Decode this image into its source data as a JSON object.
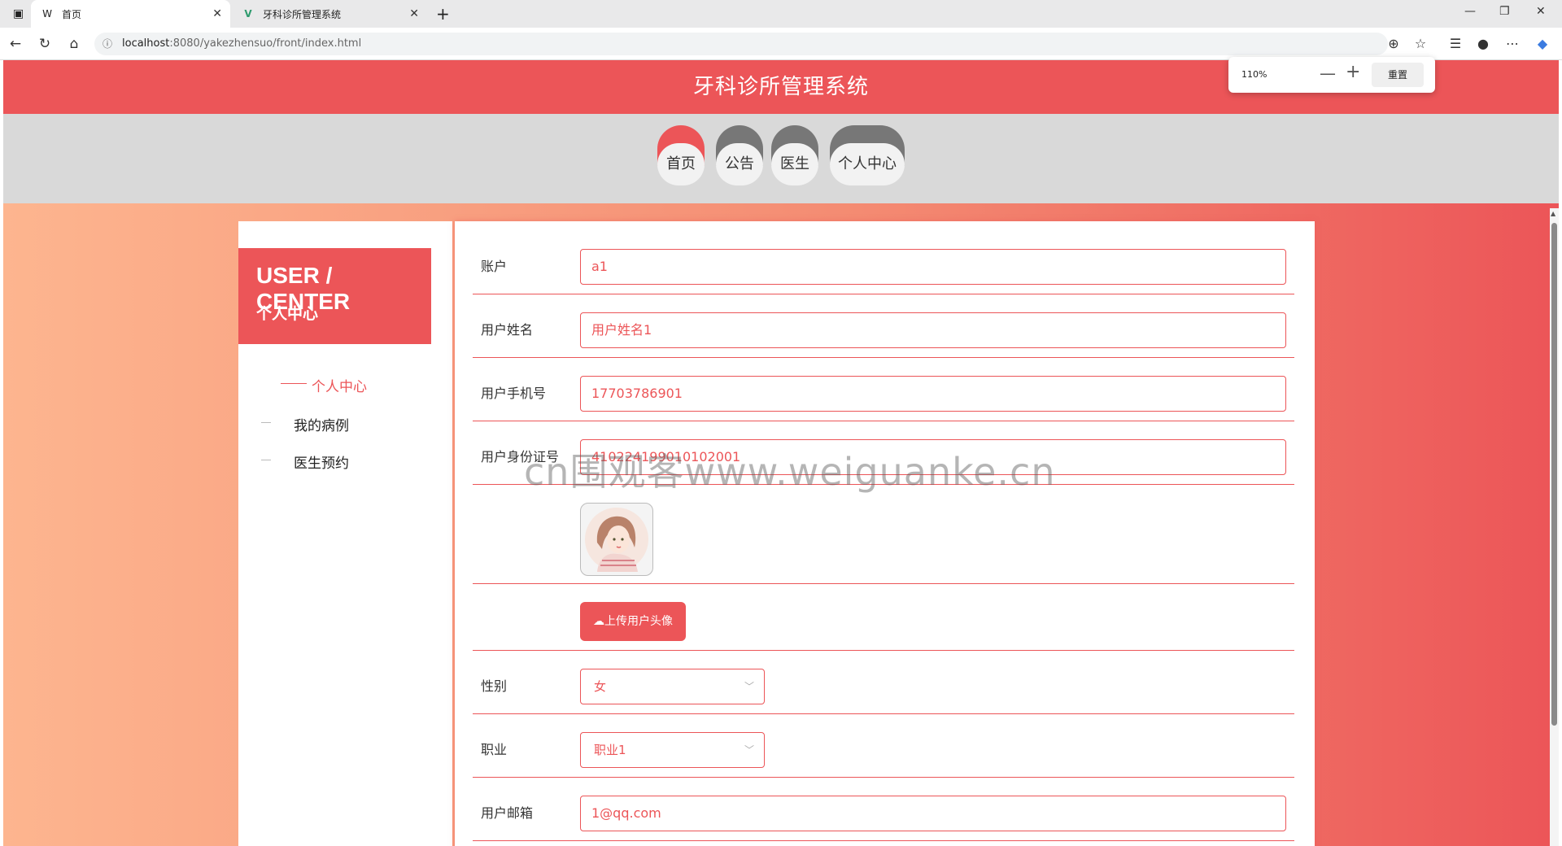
{
  "browser": {
    "tabs": [
      {
        "title": "首页",
        "favicon": "W"
      },
      {
        "title": "牙科诊所管理系统",
        "favicon": "V"
      }
    ],
    "url_host": "localhost",
    "url_rest": ":8080/yakezhensuo/front/index.html",
    "zoom": {
      "percent": "110%",
      "reset_label": "重置"
    }
  },
  "site": {
    "title": "牙科诊所管理系统",
    "nav": [
      {
        "label": "首页"
      },
      {
        "label": "公告"
      },
      {
        "label": "医生"
      },
      {
        "label": "个人中心"
      }
    ]
  },
  "sidebar": {
    "en_title": "USER / CENTER",
    "cn_title": "个人中心",
    "items": [
      {
        "label": "个人中心"
      },
      {
        "label": "我的病例"
      },
      {
        "label": "医生预约"
      }
    ]
  },
  "form": {
    "account": {
      "label": "账户",
      "value": "a1"
    },
    "name": {
      "label": "用户姓名",
      "value": "用户姓名1"
    },
    "phone": {
      "label": "用户手机号",
      "value": "17703786901"
    },
    "id_card": {
      "label": "用户身份证号",
      "value": "410224199010102001"
    },
    "upload_label": "上传用户头像",
    "gender": {
      "label": "性别",
      "value": "女"
    },
    "job": {
      "label": "职业",
      "value": "职业1"
    },
    "email": {
      "label": "用户邮箱",
      "value": "1@qq.com"
    }
  },
  "watermark": "cn围观客www.weiguanke.cn",
  "colors": {
    "brand": "#ec5558",
    "nav_bg": "#d9d9d9"
  }
}
